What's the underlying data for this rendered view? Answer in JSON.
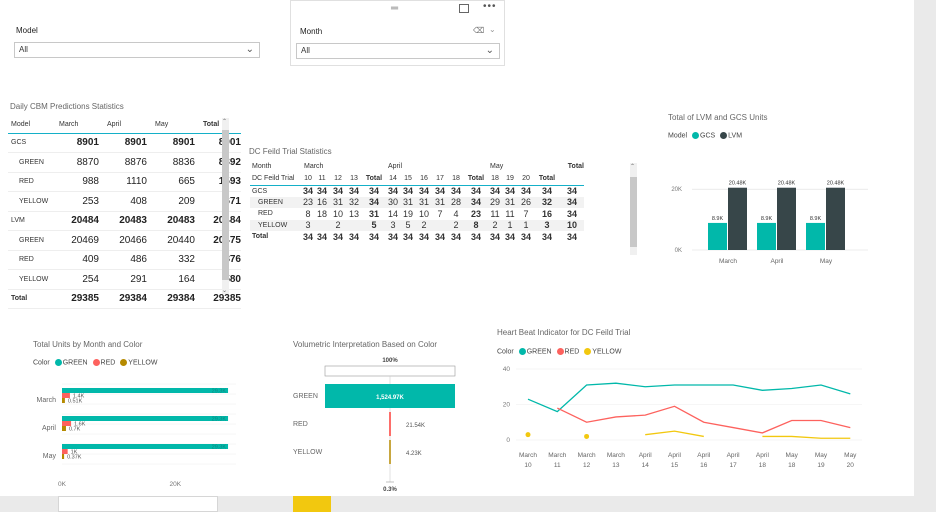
{
  "colors": {
    "teal": "#01B8AA",
    "dark": "#374649",
    "red": "#FD625E",
    "yellow": "#F2C80F",
    "gold": "#B58A00",
    "header_line": "#14b0c8"
  },
  "model_slicer": {
    "title": "Model",
    "value": "All"
  },
  "month_slicer": {
    "title": "Month",
    "value": "All",
    "icons": [
      "drag-handle-icon",
      "focus-mode-icon",
      "more-options-icon",
      "eraser-icon",
      "chevron-down-icon"
    ]
  },
  "cbm_matrix": {
    "title": "Daily CBM Predictions Statistics",
    "headers": [
      "Model",
      "March",
      "April",
      "May",
      "Total"
    ],
    "rows": [
      {
        "label": "GCS",
        "values": [
          "8901",
          "8901",
          "8901",
          "8901"
        ],
        "bold": true
      },
      {
        "label": "GREEN",
        "values": [
          "8870",
          "8876",
          "8836",
          "8892"
        ],
        "bold": false
      },
      {
        "label": "RED",
        "values": [
          "988",
          "1110",
          "665",
          "1593"
        ],
        "bold": false
      },
      {
        "label": "YELLOW",
        "values": [
          "253",
          "408",
          "209",
          "671"
        ],
        "bold": false
      },
      {
        "label": "LVM",
        "values": [
          "20484",
          "20483",
          "20483",
          "20484"
        ],
        "bold": true
      },
      {
        "label": "GREEN",
        "values": [
          "20469",
          "20466",
          "20440",
          "20475"
        ],
        "bold": false
      },
      {
        "label": "RED",
        "values": [
          "409",
          "486",
          "332",
          "876"
        ],
        "bold": false
      },
      {
        "label": "YELLOW",
        "values": [
          "254",
          "291",
          "164",
          "580"
        ],
        "bold": false
      },
      {
        "label": "Total",
        "values": [
          "29385",
          "29384",
          "29384",
          "29385"
        ],
        "bold": true
      }
    ]
  },
  "dc_matrix": {
    "title": "DC Feild Trial Statistics",
    "month_header": "Month",
    "months": [
      "March",
      "April",
      "May"
    ],
    "total_header": "Total",
    "row_header": "DC Feild Trial",
    "days": [
      "10",
      "11",
      "12",
      "13",
      "Total",
      "14",
      "15",
      "16",
      "17",
      "18",
      "Total",
      "18",
      "19",
      "20",
      "Total"
    ],
    "rows": [
      {
        "label": "GCS",
        "values": [
          "34",
          "34",
          "34",
          "34",
          "34",
          "34",
          "34",
          "34",
          "34",
          "34",
          "34",
          "34",
          "34",
          "34",
          "34",
          "34"
        ],
        "bold": true
      },
      {
        "label": "GREEN",
        "values": [
          "23",
          "16",
          "31",
          "32",
          "34",
          "30",
          "31",
          "31",
          "31",
          "28",
          "34",
          "29",
          "31",
          "26",
          "32",
          "34"
        ],
        "bold": false
      },
      {
        "label": "RED",
        "values": [
          "8",
          "18",
          "10",
          "13",
          "31",
          "14",
          "19",
          "10",
          "7",
          "4",
          "23",
          "11",
          "11",
          "7",
          "16",
          "34"
        ],
        "bold": false
      },
      {
        "label": "YELLOW",
        "values": [
          "3",
          "",
          "2",
          "",
          "5",
          "3",
          "5",
          "2",
          "",
          "2",
          "8",
          "2",
          "1",
          "1",
          "3",
          "10"
        ],
        "bold": false
      },
      {
        "label": "Total",
        "values": [
          "34",
          "34",
          "34",
          "34",
          "34",
          "34",
          "34",
          "34",
          "34",
          "34",
          "34",
          "34",
          "34",
          "34",
          "34",
          "34"
        ],
        "bold": true
      }
    ]
  },
  "lvm_chart": {
    "title": "Total of LVM and GCS Units",
    "legend_title": "Model",
    "series_names": [
      "GCS",
      "LVM"
    ],
    "y_ticks": [
      "20K",
      "0K"
    ]
  },
  "units_chart": {
    "title": "Total Units by Month and Color",
    "legend_title": "Color",
    "series_names": [
      "GREEN",
      "RED",
      "YELLOW"
    ],
    "x_ticks": [
      "0K",
      "20K"
    ]
  },
  "vol_chart": {
    "title": "Volumetric Interpretation Based on Color",
    "top_label": "100%",
    "bottom_label": "0.3%"
  },
  "hb_chart": {
    "title": "Heart Beat Indicator for DC Feild Trial",
    "legend_title": "Color",
    "series_names": [
      "GREEN",
      "RED",
      "YELLOW"
    ],
    "y_ticks": [
      "40",
      "20",
      "0"
    ]
  },
  "chart_data": [
    {
      "type": "bar",
      "title": "Total of LVM and GCS Units",
      "categories": [
        "March",
        "April",
        "May"
      ],
      "series": [
        {
          "name": "GCS",
          "values": [
            8.9,
            8.9,
            8.9
          ],
          "labels": [
            "8.9K",
            "8.9K",
            "8.9K"
          ]
        },
        {
          "name": "LVM",
          "values": [
            20.48,
            20.48,
            20.48
          ],
          "labels": [
            "20.48K",
            "20.48K",
            "20.48K"
          ]
        }
      ],
      "ylim": [
        0,
        24
      ]
    },
    {
      "type": "bar",
      "title": "Total Units by Month and Color",
      "orientation": "horizontal",
      "categories": [
        "March",
        "April",
        "May"
      ],
      "series": [
        {
          "name": "GREEN",
          "values": [
            29.3,
            29.3,
            29.3
          ],
          "labels": [
            "29.3K",
            "29.3K",
            "29.3K"
          ]
        },
        {
          "name": "RED",
          "values": [
            1.4,
            1.6,
            1.0
          ],
          "labels": [
            "1.4K",
            "1.6K",
            "1K"
          ]
        },
        {
          "name": "YELLOW",
          "values": [
            0.51,
            0.7,
            0.37
          ],
          "labels": [
            "0.51K",
            "0.7K",
            "0.37K"
          ]
        }
      ],
      "xlim": [
        0,
        30
      ]
    },
    {
      "type": "bar",
      "title": "Volumetric Interpretation Based on Color",
      "orientation": "funnel",
      "categories": [
        "GREEN",
        "RED",
        "YELLOW"
      ],
      "values": [
        1524.97,
        21.54,
        4.23
      ],
      "labels": [
        "1,524.97K",
        "21.54K",
        "4.23K"
      ]
    },
    {
      "type": "line",
      "title": "Heart Beat Indicator for DC Feild Trial",
      "x": [
        [
          "March",
          "10"
        ],
        [
          "March",
          "11"
        ],
        [
          "March",
          "12"
        ],
        [
          "March",
          "13"
        ],
        [
          "April",
          "14"
        ],
        [
          "April",
          "15"
        ],
        [
          "April",
          "16"
        ],
        [
          "April",
          "17"
        ],
        [
          "April",
          "18"
        ],
        [
          "May",
          "18"
        ],
        [
          "May",
          "19"
        ],
        [
          "May",
          "20"
        ]
      ],
      "series": [
        {
          "name": "GREEN",
          "values": [
            23,
            16,
            31,
            32,
            30,
            31,
            31,
            31,
            28,
            29,
            31,
            26
          ]
        },
        {
          "name": "RED",
          "values": [
            null,
            18,
            10,
            13,
            14,
            19,
            10,
            7,
            4,
            11,
            11,
            7
          ]
        },
        {
          "name": "YELLOW",
          "values": [
            3,
            null,
            2,
            null,
            3,
            5,
            2,
            null,
            2,
            2,
            1,
            1
          ]
        }
      ],
      "ylim": [
        0,
        40
      ]
    }
  ]
}
